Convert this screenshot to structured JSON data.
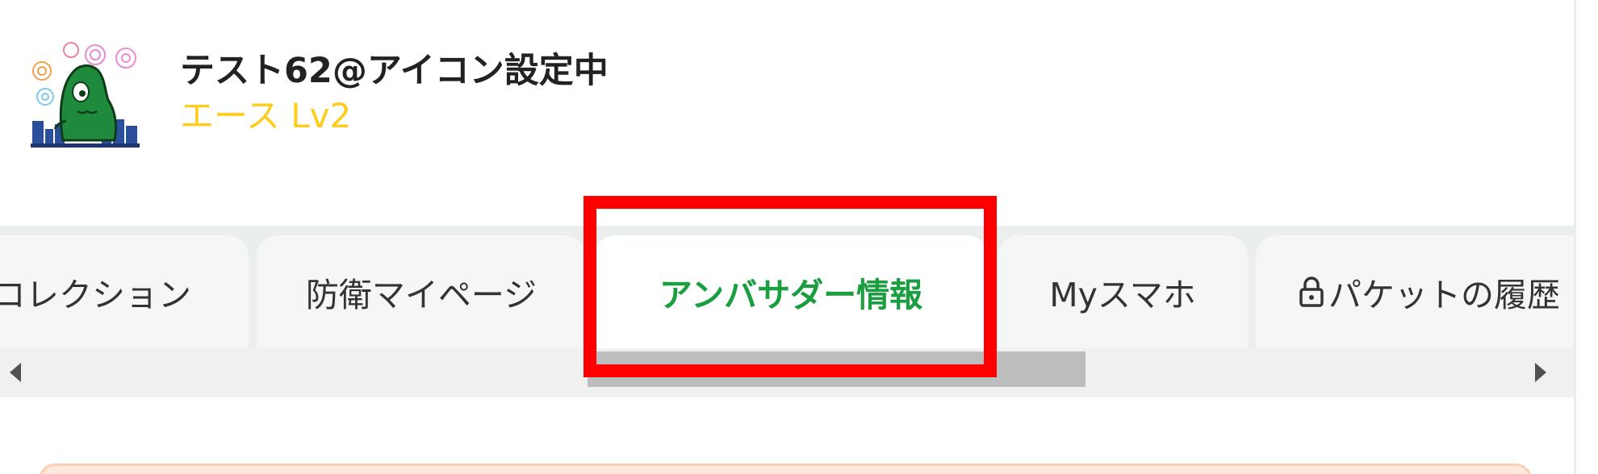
{
  "profile": {
    "username": "テスト62@アイコン設定中",
    "rank": "エース Lv2",
    "avatar_icon": "green-mascot-fireworks-avatar"
  },
  "tabs": [
    {
      "label": "コレクション",
      "active": false,
      "locked": false
    },
    {
      "label": "防衛マイページ",
      "active": false,
      "locked": false
    },
    {
      "label": "アンバサダー情報",
      "active": true,
      "locked": false
    },
    {
      "label": "Myスマホ",
      "active": false,
      "locked": false
    },
    {
      "label": "パケットの履歴",
      "active": false,
      "locked": true
    }
  ],
  "colors": {
    "active_tab_text": "#1a9e3f",
    "rank_text": "#ffcc1c",
    "highlight": "#ff0000",
    "tab_bar_bg": "#eaeeec"
  },
  "icons": {
    "scroll_left": "scroll-left-arrow-icon",
    "scroll_right": "scroll-right-arrow-icon",
    "lock": "lock-icon"
  }
}
